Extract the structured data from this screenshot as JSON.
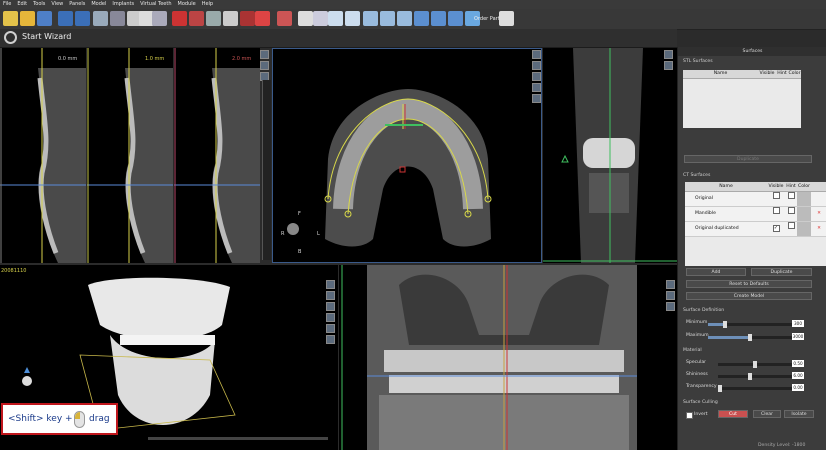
{
  "menu": [
    "File",
    "Edit",
    "Tools",
    "View",
    "Panels",
    "Model",
    "Implants",
    "Virtual Teeth",
    "Module",
    "Help"
  ],
  "toolbar": {
    "order_parts_label": "Order Parts"
  },
  "wizard": {
    "label": "Start Wizard"
  },
  "slices": [
    {
      "label": "0.0 mm"
    },
    {
      "label": "1.0 mm"
    },
    {
      "label": "2.0 mm"
    }
  ],
  "axial": {
    "orientation": [
      "F",
      "R",
      "L",
      "B"
    ]
  },
  "case_id": "20081110",
  "panel": {
    "title": "Surfaces",
    "stl": {
      "title": "STL Surfaces",
      "headers": [
        "Name",
        "Visible",
        "Hint",
        "Color"
      ],
      "duplicate_label": "Duplicate"
    },
    "ct": {
      "title": "CT Surfaces",
      "headers": [
        "Name",
        "Visible",
        "Hint",
        "Color"
      ],
      "rows": [
        {
          "name": "Original",
          "visible": false,
          "hint": false
        },
        {
          "name": "Mandible",
          "visible": false,
          "hint": false
        },
        {
          "name": "Original duplicated",
          "visible": true,
          "hint": false
        }
      ],
      "add_label": "Add",
      "duplicate_label": "Duplicate",
      "reset_label": "Reset to Defaults",
      "create_label": "Create Model"
    },
    "definition": {
      "title": "Surface Definition",
      "minimum_label": "Minimum",
      "minimum_value": "300",
      "maximum_label": "Maximum",
      "maximum_value": "3000"
    },
    "material": {
      "title": "Material",
      "specular_label": "Specular",
      "specular_value": "0.50",
      "shininess_label": "Shininess",
      "shininess_value": "6.00",
      "transparency_label": "Transparency",
      "transparency_value": "0.00"
    },
    "culling": {
      "title": "Surface Culling",
      "invert_label": "Invert",
      "cut_label": "Cut",
      "clear_label": "Clear",
      "isolate_label": "Isolate"
    },
    "status": "Density Level: -1800"
  },
  "hint": {
    "text_left": "<Shift> key +",
    "text_right": "drag"
  }
}
